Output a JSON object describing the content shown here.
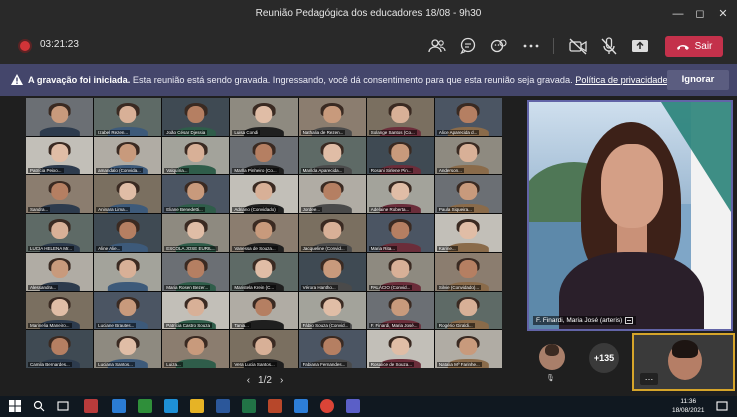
{
  "window": {
    "title": "Reunião Pedagógica dos educadores 18/08 - 9h30",
    "controls": [
      "minimize-icon",
      "maximize-icon",
      "close-icon"
    ]
  },
  "toolbar": {
    "timer": "03:21:23",
    "icons": [
      "people-icon",
      "chat-icon",
      "reactions-icon",
      "more-icon",
      "camera-off-icon",
      "mic-off-icon",
      "share-icon"
    ],
    "leave_label": "Sair",
    "leave_color": "#c4314b"
  },
  "banner": {
    "bold": "A gravação foi iniciada.",
    "text": "Esta reunião está sendo gravada. Ingressando, você dá consentimento para que esta reunião seja gravada.",
    "link": "Política de privacidade",
    "dismiss_label": "Ignorar",
    "color": "#44466b"
  },
  "gallery": {
    "page": "1/2",
    "tiles": [
      "",
      "Izabel Rezen...",
      "João César Djessia",
      "Luisa Condi",
      "Nathalia de Rezen...",
      "Solange Santos (Co...",
      "Alice Aparecida d...",
      "Patrícia Peixo...",
      "amandalo (Convida...",
      "Valquíria...",
      "Marlla Pinheiro (Co...",
      "Marilda Aparecida...",
      "Rosani Sirlene Pin...",
      "Anderson...",
      "Sandra...",
      "Aninara Lima...",
      "Eliane Benedetti...",
      "Adriano (Convidado)",
      "Jordee...",
      "Adelaine Roberta...",
      "Paula Siqueira...",
      "LUCIA HELENA Mr...",
      "Aline Alie...",
      "ESCOLA JOSE EURIL...",
      "Vanessa de Souza...",
      "Jacqueline (Convid...",
      "Maria Rita...",
      "Karine...",
      "Alessandra...",
      "",
      "Maria Rosen Bezer...",
      "Maristela Krein (C...",
      "Vérora Hantho...",
      "PALÁCIO (Convid...",
      "Silvie (Convidado)...",
      "Marinelia Maneiro...",
      "Luciane Brautes...",
      "Patrícia Castro Souza",
      "Tania...",
      "Fábio Souza (Convid...",
      "F. Finardi, Maria José...",
      "Rogério Giraldi...",
      "Camila Bernardes...",
      "Luciana Santos...",
      "Luiza...",
      "Vera Lucia Santos...",
      "Fabiana Fernandes...",
      "Rosalice de Souza...",
      "Natalia Mº Farinhe..."
    ]
  },
  "speaker": {
    "name": "F. Finardi, Maria José (arteris)"
  },
  "strip": {
    "more_count": "+135"
  },
  "taskbar": {
    "time": "11:36",
    "date": "18/08/2021"
  }
}
